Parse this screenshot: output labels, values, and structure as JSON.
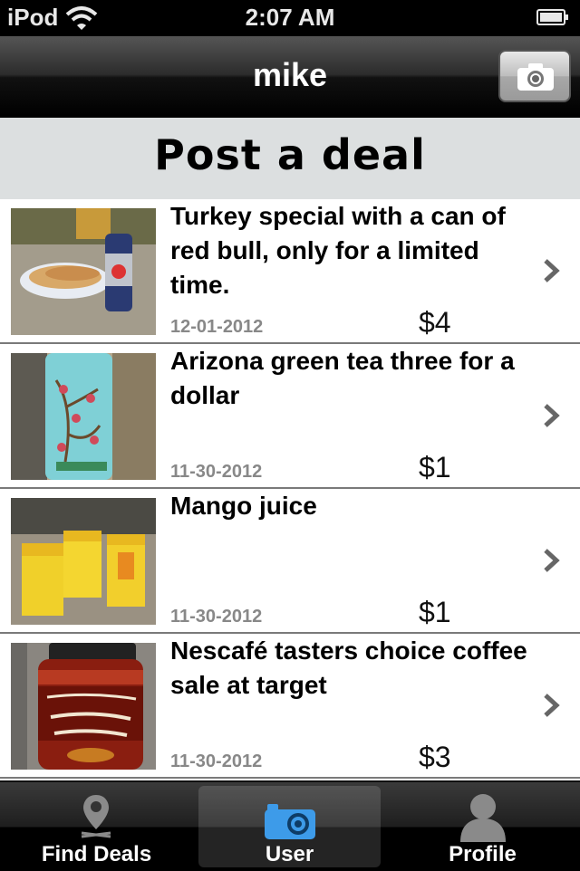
{
  "status_bar": {
    "carrier": "iPod",
    "time": "2:07 AM"
  },
  "nav": {
    "title": "mike",
    "right_button_icon": "camera-icon"
  },
  "banner": {
    "label": "Post a deal"
  },
  "deals": [
    {
      "title": "Turkey special with a can of red bull, only for a limited time.",
      "date": "12-01-2012",
      "price": "$4",
      "image": "sandwich and red bull can"
    },
    {
      "title": "Arizona green tea three for a dollar",
      "date": "11-30-2012",
      "price": "$1",
      "image": "arizona green tea can"
    },
    {
      "title": "Mango juice",
      "date": "11-30-2012",
      "price": "$1",
      "image": "mango juice boxes"
    },
    {
      "title": "Nescafé tasters choice coffee sale at target",
      "date": "11-30-2012",
      "price": "$3",
      "image": "nescafe coffee jar"
    }
  ],
  "tabs": [
    {
      "label": "Find Deals",
      "icon": "map-pin-icon",
      "selected": false
    },
    {
      "label": "User",
      "icon": "camera-icon",
      "selected": true
    },
    {
      "label": "Profile",
      "icon": "person-icon",
      "selected": false
    }
  ],
  "colors": {
    "tab_selected_icon": "#3d9be9",
    "banner_bg": "#dcdfe0"
  }
}
